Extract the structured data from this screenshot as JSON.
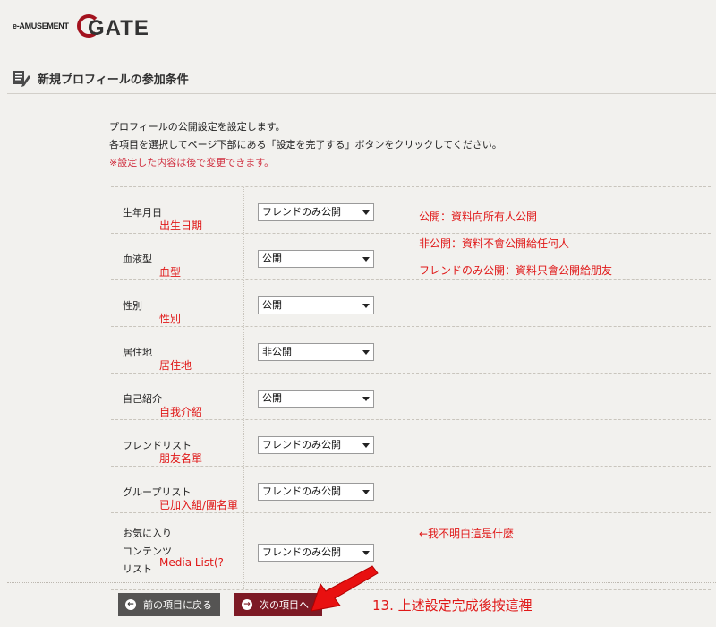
{
  "header": {
    "logo_small": "e-AMUSEMENT",
    "logo_main": "GATE",
    "brand_color": "#a3121e"
  },
  "page": {
    "title": "新規プロフィールの参加条件",
    "title_icon": "pencil-note-icon"
  },
  "intro": {
    "line1": "プロフィールの公開設定を設定します。",
    "line2": "各項目を選択してページ下部にある「設定を完了する」ボタンをクリックしてください。",
    "note": "※設定した内容は後で変更できます。"
  },
  "rows": [
    {
      "label": "生年月日",
      "annotation": "出生日期",
      "value": "フレンドのみ公開"
    },
    {
      "label": "血液型",
      "annotation": "血型",
      "value": "公開"
    },
    {
      "label": "性別",
      "annotation": "性別",
      "value": "公開"
    },
    {
      "label": "居住地",
      "annotation": "居住地",
      "value": "非公開"
    },
    {
      "label": "自己紹介",
      "annotation": "自我介紹",
      "value": "公開"
    },
    {
      "label": "フレンドリスト",
      "annotation": "朋友名單",
      "value": "フレンドのみ公開"
    },
    {
      "label": "グループリスト",
      "annotation": "已加入組/團名單",
      "value": "フレンドのみ公開"
    },
    {
      "label_lines": [
        "お気に入り",
        "コンテンツ",
        "リスト"
      ],
      "annotation": "Media List(?",
      "value": "フレンドのみ公開"
    }
  ],
  "side_notes": {
    "public": "公開：資料向所有人公開",
    "private": "非公開：資料不會公開給任何人",
    "friends": "フレンドのみ公開：資料只會公開給朋友",
    "unknown": "←我不明白這是什麼"
  },
  "buttons": {
    "back_label": "前の項目に戻る",
    "next_label": "次の項目へ",
    "back_icon": "arrow-left-icon",
    "next_icon": "arrow-right-icon"
  },
  "final_annotation": "13. 上述設定完成後按這裡",
  "annotation_color": "#e01818"
}
